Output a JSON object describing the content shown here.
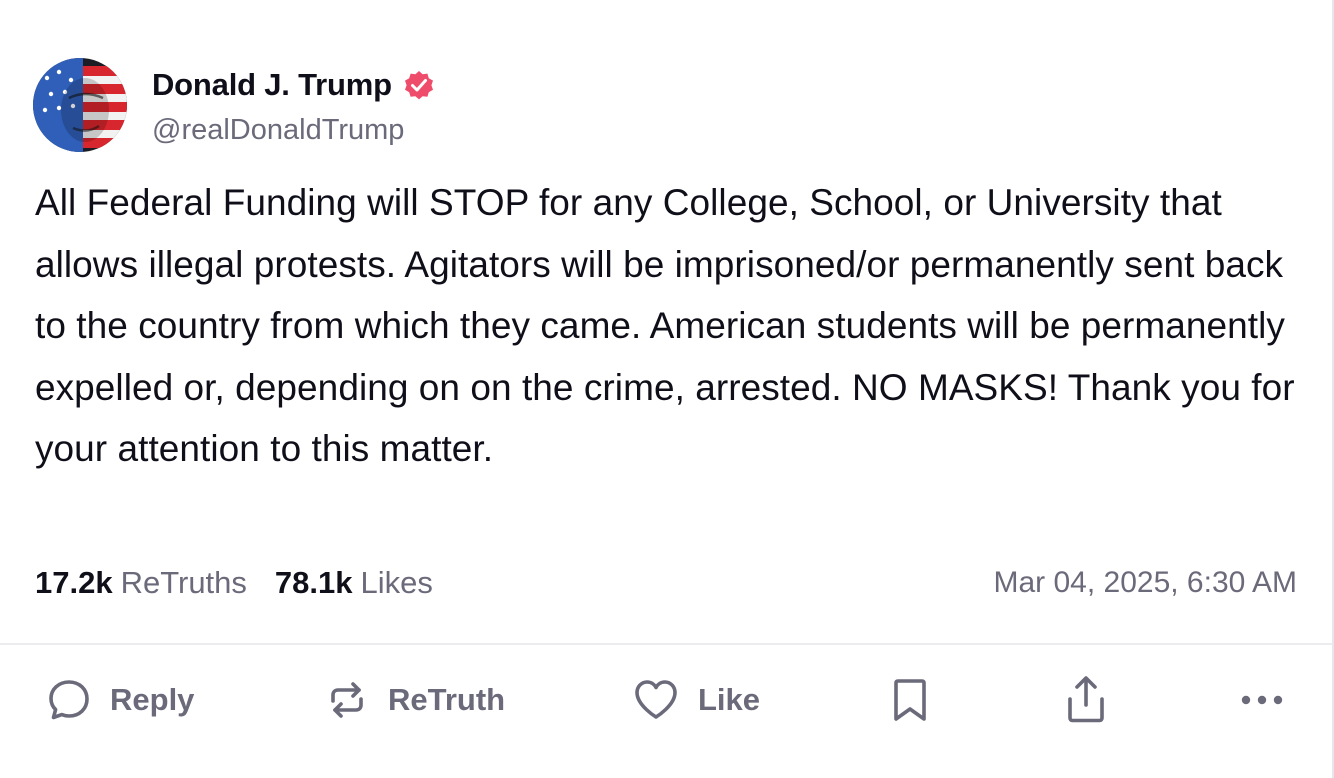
{
  "author": {
    "display_name": "Donald J. Trump",
    "handle": "@realDonaldTrump",
    "verified": true,
    "verified_color": "#ef4c6b"
  },
  "post": {
    "text": "All Federal Funding will STOP for any College, School, or University that allows illegal protests. Agitators will be imprisoned/or permanently sent back to the country from which they came. American students will be permanently expelled or, depending on on the crime, arrested. NO MASKS! Thank you for your attention to this matter."
  },
  "stats": {
    "retruths_count": "17.2k",
    "retruths_label": "ReTruths",
    "likes_count": "78.1k",
    "likes_label": "Likes",
    "timestamp": "Mar 04, 2025, 6:30 AM"
  },
  "actions": {
    "reply_label": "Reply",
    "retruth_label": "ReTruth",
    "like_label": "Like",
    "icons": [
      "reply-icon",
      "retruth-icon",
      "like-icon",
      "bookmark-icon",
      "share-icon",
      "more-icon"
    ]
  },
  "colors": {
    "text_primary": "#0f0f1a",
    "text_secondary": "#6a6a7a",
    "icon_gray": "#6a6a7a",
    "divider": "#ebebf0"
  }
}
